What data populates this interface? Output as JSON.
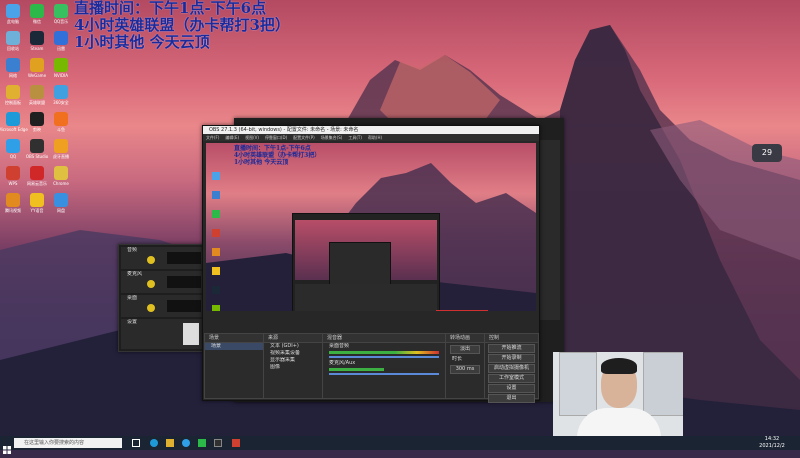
{
  "overlay": {
    "line1": "直播时间：下午1点-下午6点",
    "line2": "4小时英雄联盟（办卡帮打3把）",
    "line3": "1小时其他    今天云顶"
  },
  "desktop_icons": [
    {
      "label": "此电脑",
      "color": "#4aa3e8"
    },
    {
      "label": "回收站",
      "color": "#6fb0d8"
    },
    {
      "label": "网络",
      "color": "#3b7fd0"
    },
    {
      "label": "控制面板",
      "color": "#e0b030"
    },
    {
      "label": "Microsoft Edge",
      "color": "#1f9ad8"
    },
    {
      "label": "QQ",
      "color": "#2fa0e8"
    },
    {
      "label": "WPS",
      "color": "#d04030"
    },
    {
      "label": "腾讯视频",
      "color": "#e08a20"
    },
    {
      "label": "微信",
      "color": "#2db84a"
    },
    {
      "label": "Steam",
      "color": "#1b2838"
    },
    {
      "label": "WeGame",
      "color": "#e0a020"
    },
    {
      "label": "英雄联盟",
      "color": "#b89040"
    },
    {
      "label": "剪映",
      "color": "#202020"
    },
    {
      "label": "OBS Studio",
      "color": "#303030"
    },
    {
      "label": "网易云音乐",
      "color": "#d02828"
    },
    {
      "label": "YY语音",
      "color": "#f0c020"
    }
  ],
  "desktop_icons_col2": [
    {
      "label": "QQ音乐",
      "color": "#38c060"
    },
    {
      "label": "迅雷",
      "color": "#3070d8"
    },
    {
      "label": "NVIDIA",
      "color": "#76b900"
    },
    {
      "label": "360安全",
      "color": "#40a0e0"
    },
    {
      "label": "斗鱼",
      "color": "#f07020"
    },
    {
      "label": "虎牙直播",
      "color": "#f0a020"
    },
    {
      "label": "Chrome",
      "color": "#e0c040"
    },
    {
      "label": "网盘",
      "color": "#3a90e0"
    }
  ],
  "obs": {
    "title": "OBS 27.1.3 (64-bit, windows) - 配置文件: 未命名 - 场景: 未命名",
    "menu": [
      "文件(F)",
      "编辑(E)",
      "视图(V)",
      "停靠窗口(D)",
      "配置文件(P)",
      "场景集合(S)",
      "工具(T)",
      "帮助(H)"
    ],
    "panels": {
      "scenes": "场景",
      "sources": "来源",
      "mixer": "混音器",
      "transitions": "转场动画",
      "controls": "控制"
    },
    "scene_items": [
      "场景"
    ],
    "source_items": [
      "文本 (GDI+)",
      "视频采集设备",
      "显示器采集",
      "图像"
    ],
    "mixer_items": [
      "桌面音频",
      "麦克风/Aux"
    ],
    "transition_value": "淡出",
    "duration_label": "时长",
    "duration_value": "300 ms",
    "controls": [
      "开始推流",
      "开始录制",
      "启动虚拟摄像机",
      "工作室模式",
      "设置",
      "退出"
    ]
  },
  "left_panel": {
    "labels": [
      "音频",
      "麦克风",
      "桌面",
      "设置"
    ]
  },
  "taskbar": {
    "search_placeholder": "在这里输入你要搜索的内容",
    "time": "14:32",
    "date": "2021/12/2"
  },
  "side_widget": {
    "value": "29"
  }
}
